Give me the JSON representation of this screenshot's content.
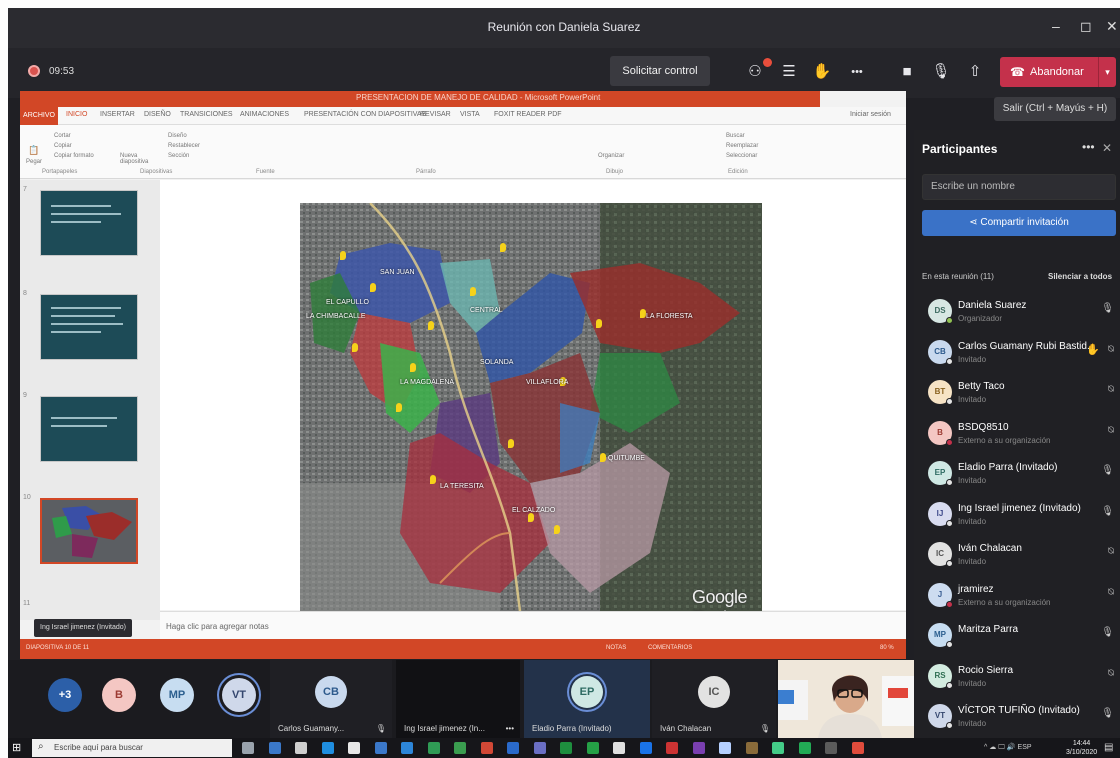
{
  "window": {
    "title": "Reunión con Daniela Suarez",
    "minimize": "–",
    "maximize": "◻",
    "close": "✕"
  },
  "controls": {
    "timer": "09:53",
    "request_control": "Solicitar control",
    "leave_label": "Abandonar",
    "leave_tooltip": "Salir (Ctrl + Mayús + H)",
    "more": "•••",
    "colors": {
      "leave": "#c4314b",
      "badge": "#e94e3c"
    }
  },
  "powerpoint": {
    "title": "PRESENTACION DE MANEJO DE CALIDAD - Microsoft PowerPoint",
    "tabs": [
      "ARCHIVO",
      "INICIO",
      "INSERTAR",
      "DISEÑO",
      "TRANSICIONES",
      "ANIMACIONES",
      "PRESENTACIÓN CON DIAPOSITIVAS",
      "REVISAR",
      "VISTA",
      "FOXIT READER PDF"
    ],
    "signin": "Iniciar sesión",
    "ribbon_groups": [
      "Portapapeles",
      "Diapositivas",
      "Fuente",
      "Párrafo",
      "Dibujo",
      "Edición"
    ],
    "ribbon_buttons": {
      "cut": "Cortar",
      "copy": "Copiar",
      "format_painter": "Copiar formato",
      "paste": "Pegar",
      "new_slide": "Nueva diapositiva",
      "layout": "Diseño",
      "reset": "Restablecer",
      "section": "Sección",
      "arrange": "Organizar",
      "find": "Buscar",
      "replace": "Reemplazar",
      "select": "Seleccionar"
    },
    "slide_numbers": [
      "7",
      "8",
      "9",
      "10",
      "11"
    ],
    "notes_placeholder": "Haga clic para agregar notas",
    "status": {
      "slide": "DIAPOSITIVA 10 DE 11",
      "notes": "NOTAS",
      "comments": "COMENTARIOS",
      "zoom": "80 %"
    }
  },
  "presenter_tag": "Ing Israel jimenez (Invitado)",
  "map": {
    "labels": [
      "EL CAPULLO",
      "SAN JUAN",
      "LA CHIMBACALLE",
      "CENTRAL",
      "LA MAGDALENA",
      "LA TERESITA",
      "VILLAFLORA",
      "SOLANDA",
      "LA FLORESTA",
      "QUITUMBE",
      "EL CALZADO"
    ],
    "logo": "Google Earth"
  },
  "participants": {
    "title": "Participantes",
    "search_placeholder": "Escribe un nombre",
    "invite_label": "Compartir invitación",
    "section": "En esta reunión (11)",
    "mute_all": "Silenciar a todos",
    "list": [
      {
        "initials": "DS",
        "name": "Daniela Suarez",
        "role": "Organizador",
        "bg": "#d7e7e3",
        "fg": "#3d6b61",
        "status": "#92c353",
        "mic": "on"
      },
      {
        "initials": "CB",
        "name": "Carlos Guamany Rubi Bastid...",
        "role": "Invitado",
        "bg": "#c9d9ee",
        "fg": "#2d5a8c",
        "status": "#e4e4e4",
        "mic": "off",
        "hand": true
      },
      {
        "initials": "BT",
        "name": "Betty Taco",
        "role": "Invitado",
        "bg": "#f6e3c5",
        "fg": "#8a6320",
        "status": "#e4e4e4",
        "mic": "off"
      },
      {
        "initials": "B",
        "name": "BSDQ8510",
        "role": "Externo a su organización",
        "bg": "#f4c7c3",
        "fg": "#9c3b33",
        "status": "#c4314b",
        "mic": "off"
      },
      {
        "initials": "EP",
        "name": "Eladio Parra (Invitado)",
        "role": "Invitado",
        "bg": "#cfe8e4",
        "fg": "#2e6b63",
        "status": "#e4e4e4",
        "mic": "on"
      },
      {
        "initials": "IJ",
        "name": "Ing Israel jimenez (Invitado)",
        "role": "Invitado",
        "bg": "#d8dcf0",
        "fg": "#3e4a8a",
        "status": "#e4e4e4",
        "mic": "on"
      },
      {
        "initials": "IC",
        "name": "Iván Chalacan",
        "role": "Invitado",
        "bg": "#e2e2e2",
        "fg": "#555555",
        "status": "#e4e4e4",
        "mic": "off"
      },
      {
        "initials": "J",
        "name": "jramirez",
        "role": "Externo a su organización",
        "bg": "#cddcf0",
        "fg": "#3b5f94",
        "status": "#c4314b",
        "mic": "off"
      },
      {
        "initials": "MP",
        "name": "Maritza Parra",
        "role": "",
        "bg": "#c7ddf1",
        "fg": "#2b5f8f",
        "status": "#e4e4e4",
        "mic": "on"
      },
      {
        "initials": "RS",
        "name": "Rocio Sierra",
        "role": "Invitado",
        "bg": "#d3ece0",
        "fg": "#2f6f52",
        "status": "#e4e4e4",
        "mic": "off"
      },
      {
        "initials": "VT",
        "name": "VÍCTOR TUFIÑO (Invitado)",
        "role": "Invitado",
        "bg": "#cfd8ea",
        "fg": "#34466e",
        "status": "#e4e4e4",
        "mic": "on"
      }
    ]
  },
  "video_strip": {
    "overflow": "+3",
    "round": [
      {
        "initials": "B",
        "bg": "#f4c7c3",
        "fg": "#9c3b33"
      },
      {
        "initials": "MP",
        "bg": "#c7ddf1",
        "fg": "#2b5f8f"
      },
      {
        "initials": "VT",
        "bg": "#cfd8ea",
        "fg": "#34466e"
      }
    ],
    "tiles": [
      {
        "initials": "CB",
        "name": "Carlos Guamany...",
        "bg": "#c9d9ee",
        "fg": "#2d5a8c",
        "tile_bg": "#1f1f24",
        "mic": "🎙"
      },
      {
        "initials": "",
        "name": "Ing Israel jimenez (In...",
        "bg": "#1b1b1f",
        "fg": "#fff",
        "tile_bg": "#111114",
        "mic": "•••"
      },
      {
        "initials": "EP",
        "name": "Eladio Parra (Invitado)",
        "bg": "#cfe8e4",
        "fg": "#2e6b63",
        "tile_bg": "#23324a",
        "mic": ""
      },
      {
        "initials": "IC",
        "name": "Iván Chalacan",
        "bg": "#e2e2e2",
        "fg": "#555",
        "tile_bg": "#1f1f24",
        "mic": "🎙"
      }
    ]
  },
  "taskbar": {
    "search_placeholder": "Escribe aquí para buscar",
    "tray": "^ ☁ 🖵 🔊 ESP",
    "time": "14:44",
    "date": "3/10/2020"
  }
}
